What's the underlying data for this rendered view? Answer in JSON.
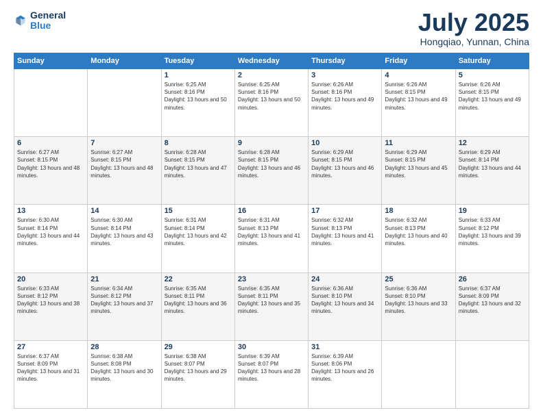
{
  "logo": {
    "general": "General",
    "blue": "Blue"
  },
  "title": "July 2025",
  "location": "Hongqiao, Yunnan, China",
  "days_of_week": [
    "Sunday",
    "Monday",
    "Tuesday",
    "Wednesday",
    "Thursday",
    "Friday",
    "Saturday"
  ],
  "weeks": [
    {
      "shaded": false,
      "days": [
        {
          "date": "",
          "sunrise": "",
          "sunset": "",
          "daylight": ""
        },
        {
          "date": "",
          "sunrise": "",
          "sunset": "",
          "daylight": ""
        },
        {
          "date": "1",
          "sunrise": "Sunrise: 6:25 AM",
          "sunset": "Sunset: 8:16 PM",
          "daylight": "Daylight: 13 hours and 50 minutes."
        },
        {
          "date": "2",
          "sunrise": "Sunrise: 6:25 AM",
          "sunset": "Sunset: 8:16 PM",
          "daylight": "Daylight: 13 hours and 50 minutes."
        },
        {
          "date": "3",
          "sunrise": "Sunrise: 6:26 AM",
          "sunset": "Sunset: 8:16 PM",
          "daylight": "Daylight: 13 hours and 49 minutes."
        },
        {
          "date": "4",
          "sunrise": "Sunrise: 6:26 AM",
          "sunset": "Sunset: 8:15 PM",
          "daylight": "Daylight: 13 hours and 49 minutes."
        },
        {
          "date": "5",
          "sunrise": "Sunrise: 6:26 AM",
          "sunset": "Sunset: 8:15 PM",
          "daylight": "Daylight: 13 hours and 49 minutes."
        }
      ]
    },
    {
      "shaded": true,
      "days": [
        {
          "date": "6",
          "sunrise": "Sunrise: 6:27 AM",
          "sunset": "Sunset: 8:15 PM",
          "daylight": "Daylight: 13 hours and 48 minutes."
        },
        {
          "date": "7",
          "sunrise": "Sunrise: 6:27 AM",
          "sunset": "Sunset: 8:15 PM",
          "daylight": "Daylight: 13 hours and 48 minutes."
        },
        {
          "date": "8",
          "sunrise": "Sunrise: 6:28 AM",
          "sunset": "Sunset: 8:15 PM",
          "daylight": "Daylight: 13 hours and 47 minutes."
        },
        {
          "date": "9",
          "sunrise": "Sunrise: 6:28 AM",
          "sunset": "Sunset: 8:15 PM",
          "daylight": "Daylight: 13 hours and 46 minutes."
        },
        {
          "date": "10",
          "sunrise": "Sunrise: 6:29 AM",
          "sunset": "Sunset: 8:15 PM",
          "daylight": "Daylight: 13 hours and 46 minutes."
        },
        {
          "date": "11",
          "sunrise": "Sunrise: 6:29 AM",
          "sunset": "Sunset: 8:15 PM",
          "daylight": "Daylight: 13 hours and 45 minutes."
        },
        {
          "date": "12",
          "sunrise": "Sunrise: 6:29 AM",
          "sunset": "Sunset: 8:14 PM",
          "daylight": "Daylight: 13 hours and 44 minutes."
        }
      ]
    },
    {
      "shaded": false,
      "days": [
        {
          "date": "13",
          "sunrise": "Sunrise: 6:30 AM",
          "sunset": "Sunset: 8:14 PM",
          "daylight": "Daylight: 13 hours and 44 minutes."
        },
        {
          "date": "14",
          "sunrise": "Sunrise: 6:30 AM",
          "sunset": "Sunset: 8:14 PM",
          "daylight": "Daylight: 13 hours and 43 minutes."
        },
        {
          "date": "15",
          "sunrise": "Sunrise: 6:31 AM",
          "sunset": "Sunset: 8:14 PM",
          "daylight": "Daylight: 13 hours and 42 minutes."
        },
        {
          "date": "16",
          "sunrise": "Sunrise: 6:31 AM",
          "sunset": "Sunset: 8:13 PM",
          "daylight": "Daylight: 13 hours and 41 minutes."
        },
        {
          "date": "17",
          "sunrise": "Sunrise: 6:32 AM",
          "sunset": "Sunset: 8:13 PM",
          "daylight": "Daylight: 13 hours and 41 minutes."
        },
        {
          "date": "18",
          "sunrise": "Sunrise: 6:32 AM",
          "sunset": "Sunset: 8:13 PM",
          "daylight": "Daylight: 13 hours and 40 minutes."
        },
        {
          "date": "19",
          "sunrise": "Sunrise: 6:33 AM",
          "sunset": "Sunset: 8:12 PM",
          "daylight": "Daylight: 13 hours and 39 minutes."
        }
      ]
    },
    {
      "shaded": true,
      "days": [
        {
          "date": "20",
          "sunrise": "Sunrise: 6:33 AM",
          "sunset": "Sunset: 8:12 PM",
          "daylight": "Daylight: 13 hours and 38 minutes."
        },
        {
          "date": "21",
          "sunrise": "Sunrise: 6:34 AM",
          "sunset": "Sunset: 8:12 PM",
          "daylight": "Daylight: 13 hours and 37 minutes."
        },
        {
          "date": "22",
          "sunrise": "Sunrise: 6:35 AM",
          "sunset": "Sunset: 8:11 PM",
          "daylight": "Daylight: 13 hours and 36 minutes."
        },
        {
          "date": "23",
          "sunrise": "Sunrise: 6:35 AM",
          "sunset": "Sunset: 8:11 PM",
          "daylight": "Daylight: 13 hours and 35 minutes."
        },
        {
          "date": "24",
          "sunrise": "Sunrise: 6:36 AM",
          "sunset": "Sunset: 8:10 PM",
          "daylight": "Daylight: 13 hours and 34 minutes."
        },
        {
          "date": "25",
          "sunrise": "Sunrise: 6:36 AM",
          "sunset": "Sunset: 8:10 PM",
          "daylight": "Daylight: 13 hours and 33 minutes."
        },
        {
          "date": "26",
          "sunrise": "Sunrise: 6:37 AM",
          "sunset": "Sunset: 8:09 PM",
          "daylight": "Daylight: 13 hours and 32 minutes."
        }
      ]
    },
    {
      "shaded": false,
      "days": [
        {
          "date": "27",
          "sunrise": "Sunrise: 6:37 AM",
          "sunset": "Sunset: 8:09 PM",
          "daylight": "Daylight: 13 hours and 31 minutes."
        },
        {
          "date": "28",
          "sunrise": "Sunrise: 6:38 AM",
          "sunset": "Sunset: 8:08 PM",
          "daylight": "Daylight: 13 hours and 30 minutes."
        },
        {
          "date": "29",
          "sunrise": "Sunrise: 6:38 AM",
          "sunset": "Sunset: 8:07 PM",
          "daylight": "Daylight: 13 hours and 29 minutes."
        },
        {
          "date": "30",
          "sunrise": "Sunrise: 6:39 AM",
          "sunset": "Sunset: 8:07 PM",
          "daylight": "Daylight: 13 hours and 28 minutes."
        },
        {
          "date": "31",
          "sunrise": "Sunrise: 6:39 AM",
          "sunset": "Sunset: 8:06 PM",
          "daylight": "Daylight: 13 hours and 26 minutes."
        },
        {
          "date": "",
          "sunrise": "",
          "sunset": "",
          "daylight": ""
        },
        {
          "date": "",
          "sunrise": "",
          "sunset": "",
          "daylight": ""
        }
      ]
    }
  ]
}
